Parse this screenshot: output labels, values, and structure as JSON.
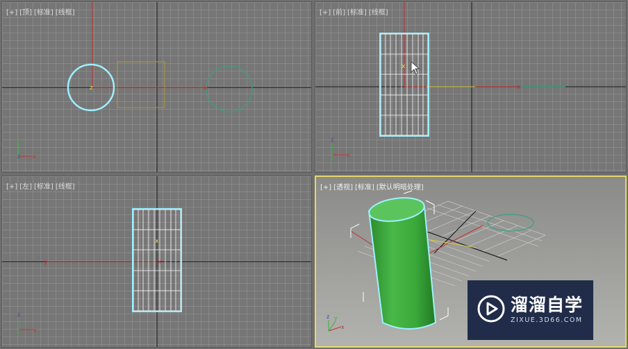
{
  "viewports": {
    "top": {
      "labels": [
        "[+]",
        "[顶]",
        "[标准]",
        "[线框]"
      ]
    },
    "front": {
      "labels": [
        "[+]",
        "[前]",
        "[标准]",
        "[线框]"
      ]
    },
    "left": {
      "labels": [
        "[+]",
        "[左]",
        "[标准]",
        "[线框]"
      ]
    },
    "perspective": {
      "labels": [
        "[+]",
        "[透视]",
        "[标准]",
        "[默认明暗处理]"
      ]
    }
  },
  "axes": {
    "x": "x",
    "y": "y",
    "z": "z"
  },
  "colors": {
    "grid": "#969696",
    "axis_line": "#2b2b2b",
    "selection": "#9ef0ff",
    "cylinder": "#3cad3c",
    "red_axis": "#c23030",
    "yellow_axis": "#d8cc3c",
    "teal_object": "#3aa085",
    "active_border": "#e6d86a"
  },
  "watermark": {
    "title": "溜溜自学",
    "subtitle": "ZIXUE.3D66.COM",
    "icon": "play-logo-icon"
  }
}
